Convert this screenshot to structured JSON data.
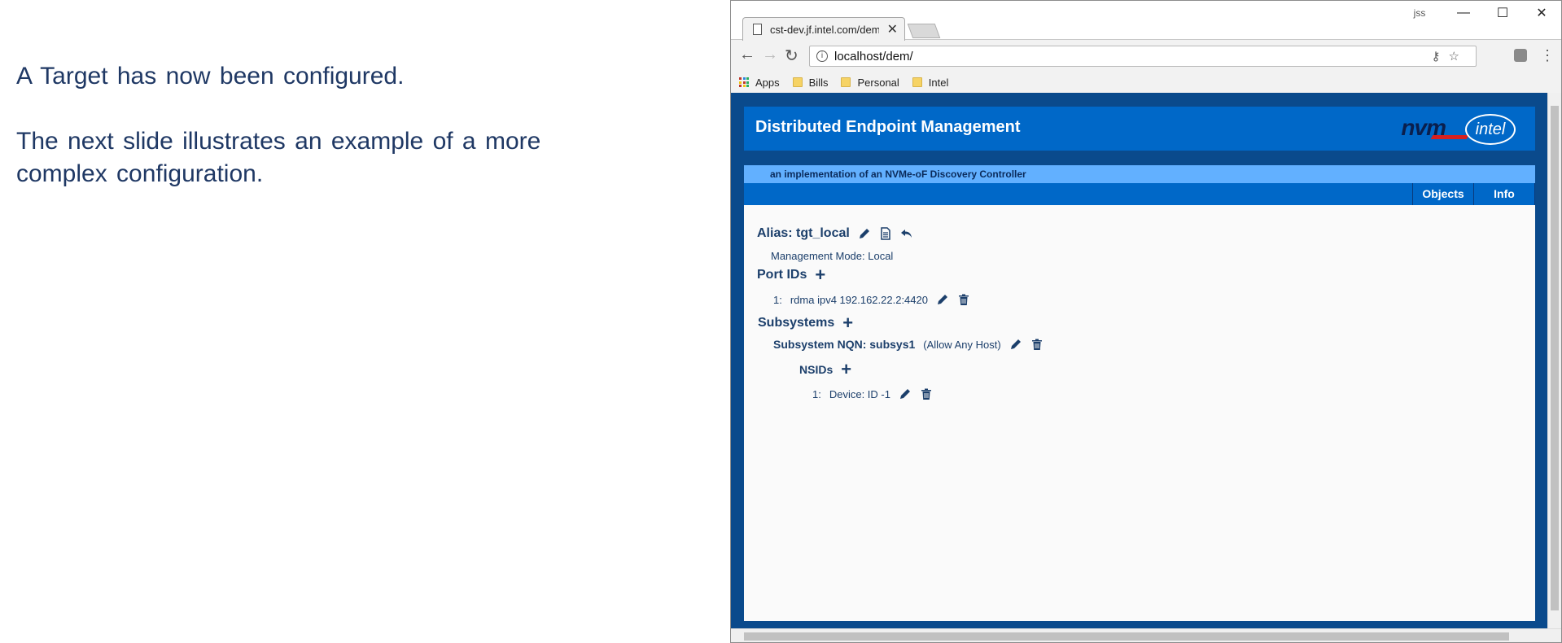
{
  "slide": {
    "line1": "A Target has now been configured.",
    "line2": "The next slide illustrates an example of a more complex configuration."
  },
  "browser": {
    "tab_title": "cst-dev.jf.intel.com/dem/",
    "url": "localhost/dem/",
    "window_user": "jss",
    "bookmarks": [
      {
        "label": "Apps"
      },
      {
        "label": "Bills"
      },
      {
        "label": "Personal"
      },
      {
        "label": "Intel"
      }
    ]
  },
  "app": {
    "title": "Distributed Endpoint Management",
    "logo_nvm": "nvm",
    "logo_intel": "intel",
    "subtitle": "an implementation of an NVMe-oF Discovery Controller",
    "tabs": [
      "Objects",
      "Info"
    ]
  },
  "target": {
    "alias_label": "Alias: tgt_local",
    "management_mode": "Management Mode: Local",
    "port_ids_header": "Port IDs",
    "ports": [
      {
        "index": "1:",
        "value": "rdma ipv4 192.162.22.2:4420"
      }
    ],
    "subsystems_header": "Subsystems",
    "subsystem": {
      "nqn_label": "Subsystem NQN: subsys1",
      "host_policy": "(Allow Any Host)",
      "nsids_header": "NSIDs",
      "nsids": [
        {
          "index": "1:",
          "value": "Device: ID -1"
        }
      ]
    }
  },
  "colors": {
    "page_blue": "#0a4a8c",
    "header_blue": "#0068c8",
    "subheader_blue": "#62b0ff",
    "text_navy": "#1c3f6b",
    "slide_text": "#1f3864"
  },
  "icons": [
    "pencil-icon",
    "document-icon",
    "undo-icon",
    "plus-icon",
    "trash-icon"
  ]
}
